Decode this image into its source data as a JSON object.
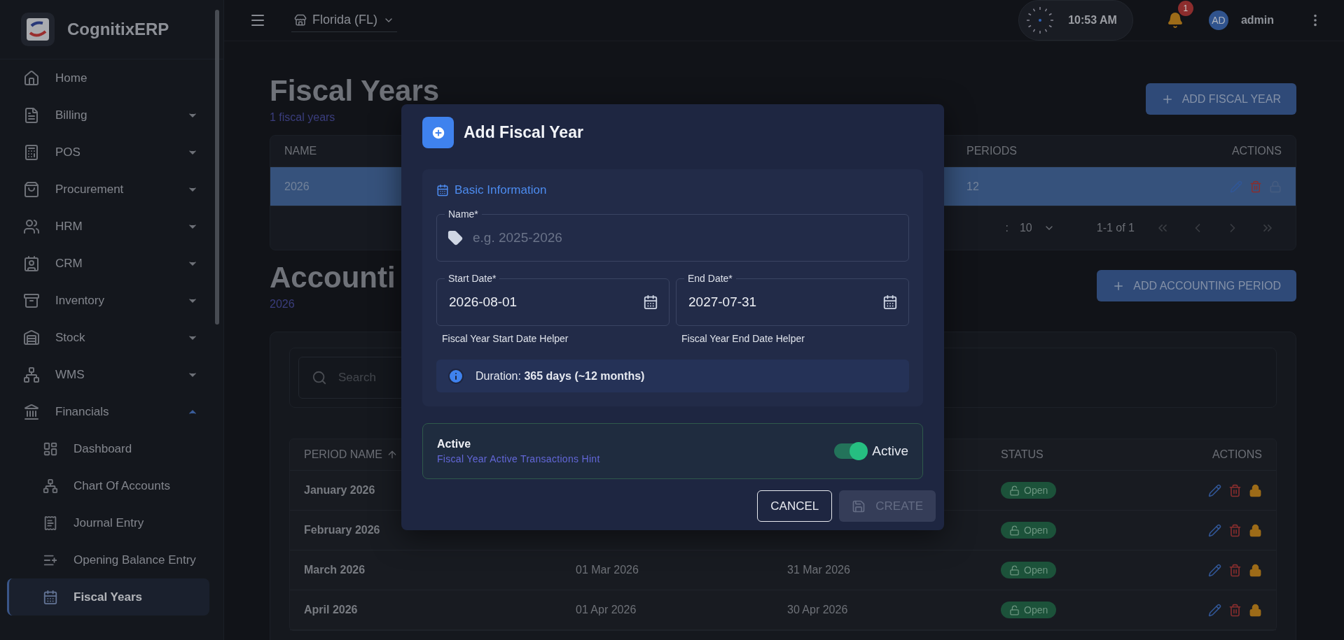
{
  "app": {
    "name": "CognitixERP"
  },
  "sidebar": {
    "items": [
      {
        "label": "Home",
        "kind": "link",
        "selected": false
      },
      {
        "label": "Billing",
        "kind": "group",
        "expanded": false,
        "selected": false
      },
      {
        "label": "POS",
        "kind": "group",
        "expanded": false,
        "selected": false
      },
      {
        "label": "Procurement",
        "kind": "group",
        "expanded": false,
        "selected": false
      },
      {
        "label": "HRM",
        "kind": "group",
        "expanded": false,
        "selected": false
      },
      {
        "label": "CRM",
        "kind": "group",
        "expanded": false,
        "selected": false
      },
      {
        "label": "Inventory",
        "kind": "group",
        "expanded": false,
        "selected": false
      },
      {
        "label": "Stock",
        "kind": "group",
        "expanded": false,
        "selected": false
      },
      {
        "label": "WMS",
        "kind": "group",
        "expanded": false,
        "selected": false
      },
      {
        "label": "Financials",
        "kind": "group",
        "expanded": true,
        "selected": false,
        "children": [
          {
            "label": "Dashboard",
            "selected": false
          },
          {
            "label": "Chart Of Accounts",
            "selected": false
          },
          {
            "label": "Journal Entry",
            "selected": false
          },
          {
            "label": "Opening Balance Entry",
            "selected": false
          },
          {
            "label": "Fiscal Years",
            "selected": true
          }
        ]
      }
    ]
  },
  "topbar": {
    "store": "Florida (FL)",
    "time": "10:53 AM",
    "notifications": "1",
    "avatar": "AD",
    "user": "admin"
  },
  "fiscal_years": {
    "title": "Fiscal Years",
    "subtitle": "1 fiscal years",
    "add_button": "ADD FISCAL YEAR",
    "table": {
      "columns": [
        "NAME",
        "PERIODS",
        "ACTIONS"
      ],
      "rows": [
        {
          "name": "2026",
          "periods": "12",
          "selected": true
        }
      ]
    },
    "pagination": {
      "rows_per_page_label": ":",
      "rows_per_page": "10",
      "range": "1-1 of 1"
    }
  },
  "accounting_periods": {
    "title": "Accounti",
    "subtitle": "2026",
    "add_button": "ADD ACCOUNTING PERIOD",
    "search": {
      "placeholder": "Search"
    },
    "table": {
      "columns": [
        {
          "label": "PERIOD NAME",
          "sorted": true
        },
        {
          "label": "STATUS",
          "sorted": false
        },
        {
          "label": "ACTIONS",
          "sorted": false
        }
      ],
      "rows": [
        {
          "name": "January 2026",
          "status": "Open"
        },
        {
          "name": "February 2026",
          "status": "Open"
        },
        {
          "name": "March 2026",
          "start": "01 Mar 2026",
          "end": "31 Mar 2026",
          "status": "Open"
        },
        {
          "name": "April 2026",
          "start": "01 Apr 2026",
          "end": "30 Apr 2026",
          "status": "Open"
        }
      ]
    }
  },
  "dialog": {
    "title": "Add Fiscal Year",
    "section": {
      "title": "Basic Information",
      "name_field": {
        "label": "Name*",
        "placeholder": "e.g. 2025-2026"
      },
      "date_fields": [
        {
          "label": "Start Date*",
          "value": "2026-08-01",
          "helper": "Fiscal Year Start Date Helper"
        },
        {
          "label": "End Date*",
          "value": "2027-07-31",
          "helper": "Fiscal Year End Date Helper"
        }
      ],
      "duration": "Duration: **365 days (~12 months)**"
    },
    "active": {
      "title": "Active",
      "hint": "Fiscal Year Active Transactions Hint",
      "switch": {
        "on": true,
        "label": "Active"
      }
    },
    "buttons": [
      {
        "label": "CANCEL",
        "kind": "outlined",
        "disabled": false
      },
      {
        "label": "CREATE",
        "kind": "submit",
        "disabled": true
      }
    ]
  }
}
